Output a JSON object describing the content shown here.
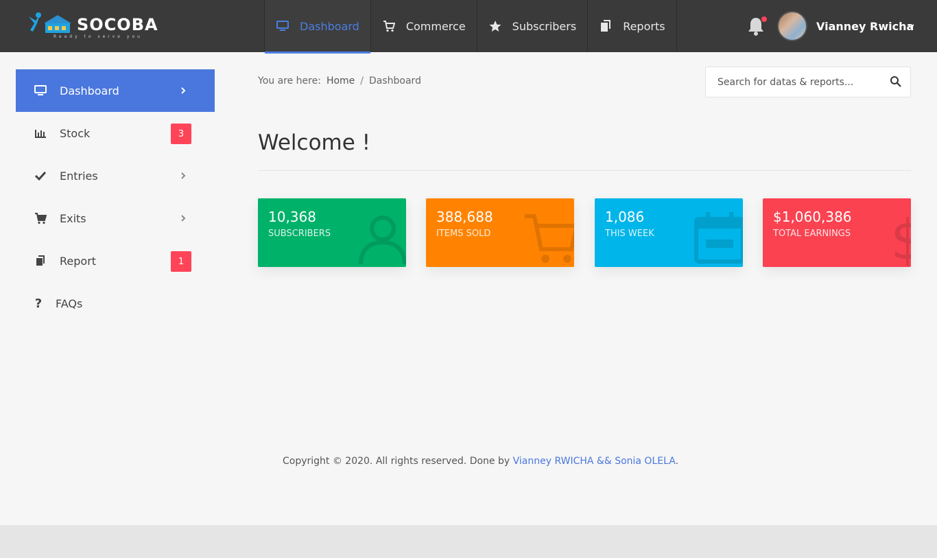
{
  "brand": {
    "name": "SOCOBA",
    "tagline": "Ready to serve you"
  },
  "topnav": [
    {
      "label": "Dashboard",
      "icon": "monitor-icon",
      "active": true
    },
    {
      "label": "Commerce",
      "icon": "cart-icon"
    },
    {
      "label": "Subscribers",
      "icon": "star-icon"
    },
    {
      "label": "Reports",
      "icon": "copy-icon"
    }
  ],
  "user": {
    "name": "Vianney Rwicha"
  },
  "sidebar": {
    "items": [
      {
        "label": "Dashboard",
        "icon": "monitor-icon",
        "active": true
      },
      {
        "label": "Stock",
        "icon": "bar-chart-icon",
        "badge": "3"
      },
      {
        "label": "Entries",
        "icon": "check-icon"
      },
      {
        "label": "Exits",
        "icon": "cart-icon"
      },
      {
        "label": "Report",
        "icon": "copy-icon",
        "badge": "1"
      },
      {
        "label": "FAQs",
        "icon": "question-icon"
      }
    ]
  },
  "breadcrumb": {
    "prefix": "You are here:",
    "home": "Home",
    "sep": "/",
    "current": "Dashboard"
  },
  "search": {
    "placeholder": "Search for datas & reports..."
  },
  "welcome": "Welcome !",
  "stats": [
    {
      "value": "10,368",
      "label": "SUBSCRIBERS",
      "color": "#00b16a",
      "icon": "user-icon"
    },
    {
      "value": "388,688",
      "label": "ITEMS SOLD",
      "color": "#ff8300",
      "icon": "cart-icon"
    },
    {
      "value": "1,086",
      "label": "THIS WEEK",
      "color": "#00b5e9",
      "icon": "calendar-icon"
    },
    {
      "value": "$1,060,386",
      "label": "TOTAL EARNINGS",
      "color": "#fa4251",
      "icon": "dollar-icon"
    }
  ],
  "footer": {
    "text": "Copyright © 2020. All rights reserved. Done by ",
    "link": "Vianney RWICHA && Sonia OLELA",
    "end": "."
  },
  "colors": {
    "topbar": "#3a3a3a",
    "accent": "#4a77dd",
    "badge": "#ff4458"
  }
}
